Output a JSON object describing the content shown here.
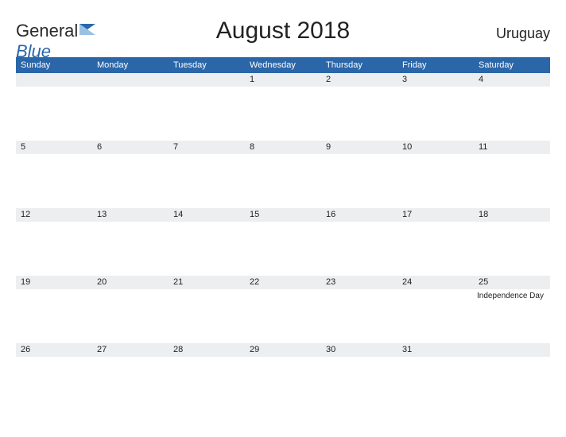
{
  "brand": {
    "general": "General",
    "blue": "Blue"
  },
  "title": "August 2018",
  "locale": "Uruguay",
  "daynames": [
    "Sunday",
    "Monday",
    "Tuesday",
    "Wednesday",
    "Thursday",
    "Friday",
    "Saturday"
  ],
  "weeks": [
    {
      "dates": [
        "",
        "",
        "",
        "1",
        "2",
        "3",
        "4"
      ],
      "events": [
        "",
        "",
        "",
        "",
        "",
        "",
        ""
      ]
    },
    {
      "dates": [
        "5",
        "6",
        "7",
        "8",
        "9",
        "10",
        "11"
      ],
      "events": [
        "",
        "",
        "",
        "",
        "",
        "",
        ""
      ]
    },
    {
      "dates": [
        "12",
        "13",
        "14",
        "15",
        "16",
        "17",
        "18"
      ],
      "events": [
        "",
        "",
        "",
        "",
        "",
        "",
        ""
      ]
    },
    {
      "dates": [
        "19",
        "20",
        "21",
        "22",
        "23",
        "24",
        "25"
      ],
      "events": [
        "",
        "",
        "",
        "",
        "",
        "",
        "Independence Day"
      ]
    },
    {
      "dates": [
        "26",
        "27",
        "28",
        "29",
        "30",
        "31",
        ""
      ],
      "events": [
        "",
        "",
        "",
        "",
        "",
        "",
        ""
      ]
    }
  ]
}
